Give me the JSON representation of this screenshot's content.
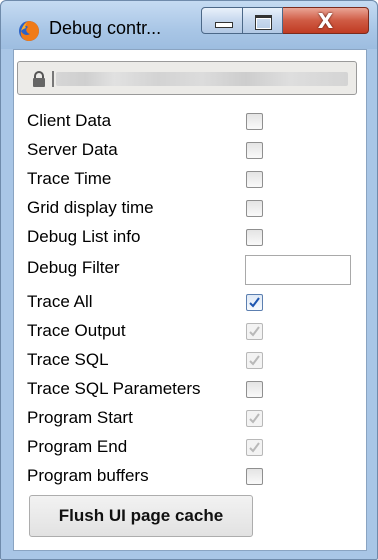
{
  "window": {
    "title": "Debug contr...",
    "minimize_icon": "minimize-icon",
    "maximize_icon": "maximize-icon",
    "close_label": "X"
  },
  "addressbar": {
    "lock_icon": "lock-icon"
  },
  "options": [
    {
      "label": "Client Data",
      "checked": false,
      "disabled": false
    },
    {
      "label": "Server Data",
      "checked": false,
      "disabled": false
    },
    {
      "label": "Trace Time",
      "checked": false,
      "disabled": false
    },
    {
      "label": "Grid display time",
      "checked": false,
      "disabled": false
    },
    {
      "label": "Debug List info",
      "checked": false,
      "disabled": false
    },
    {
      "label": "Trace All",
      "checked": true,
      "disabled": false
    },
    {
      "label": "Trace Output",
      "checked": true,
      "disabled": true
    },
    {
      "label": "Trace SQL",
      "checked": true,
      "disabled": true
    },
    {
      "label": "Trace SQL Parameters",
      "checked": false,
      "disabled": false
    },
    {
      "label": "Program Start",
      "checked": true,
      "disabled": true
    },
    {
      "label": "Program End",
      "checked": true,
      "disabled": true
    },
    {
      "label": "Program buffers",
      "checked": false,
      "disabled": false
    }
  ],
  "debug_filter": {
    "label": "Debug Filter",
    "value": ""
  },
  "flush_button_label": "Flush UI page cache",
  "colors": {
    "check_active": "#1e56b0",
    "check_disabled": "#b9b9b9"
  }
}
